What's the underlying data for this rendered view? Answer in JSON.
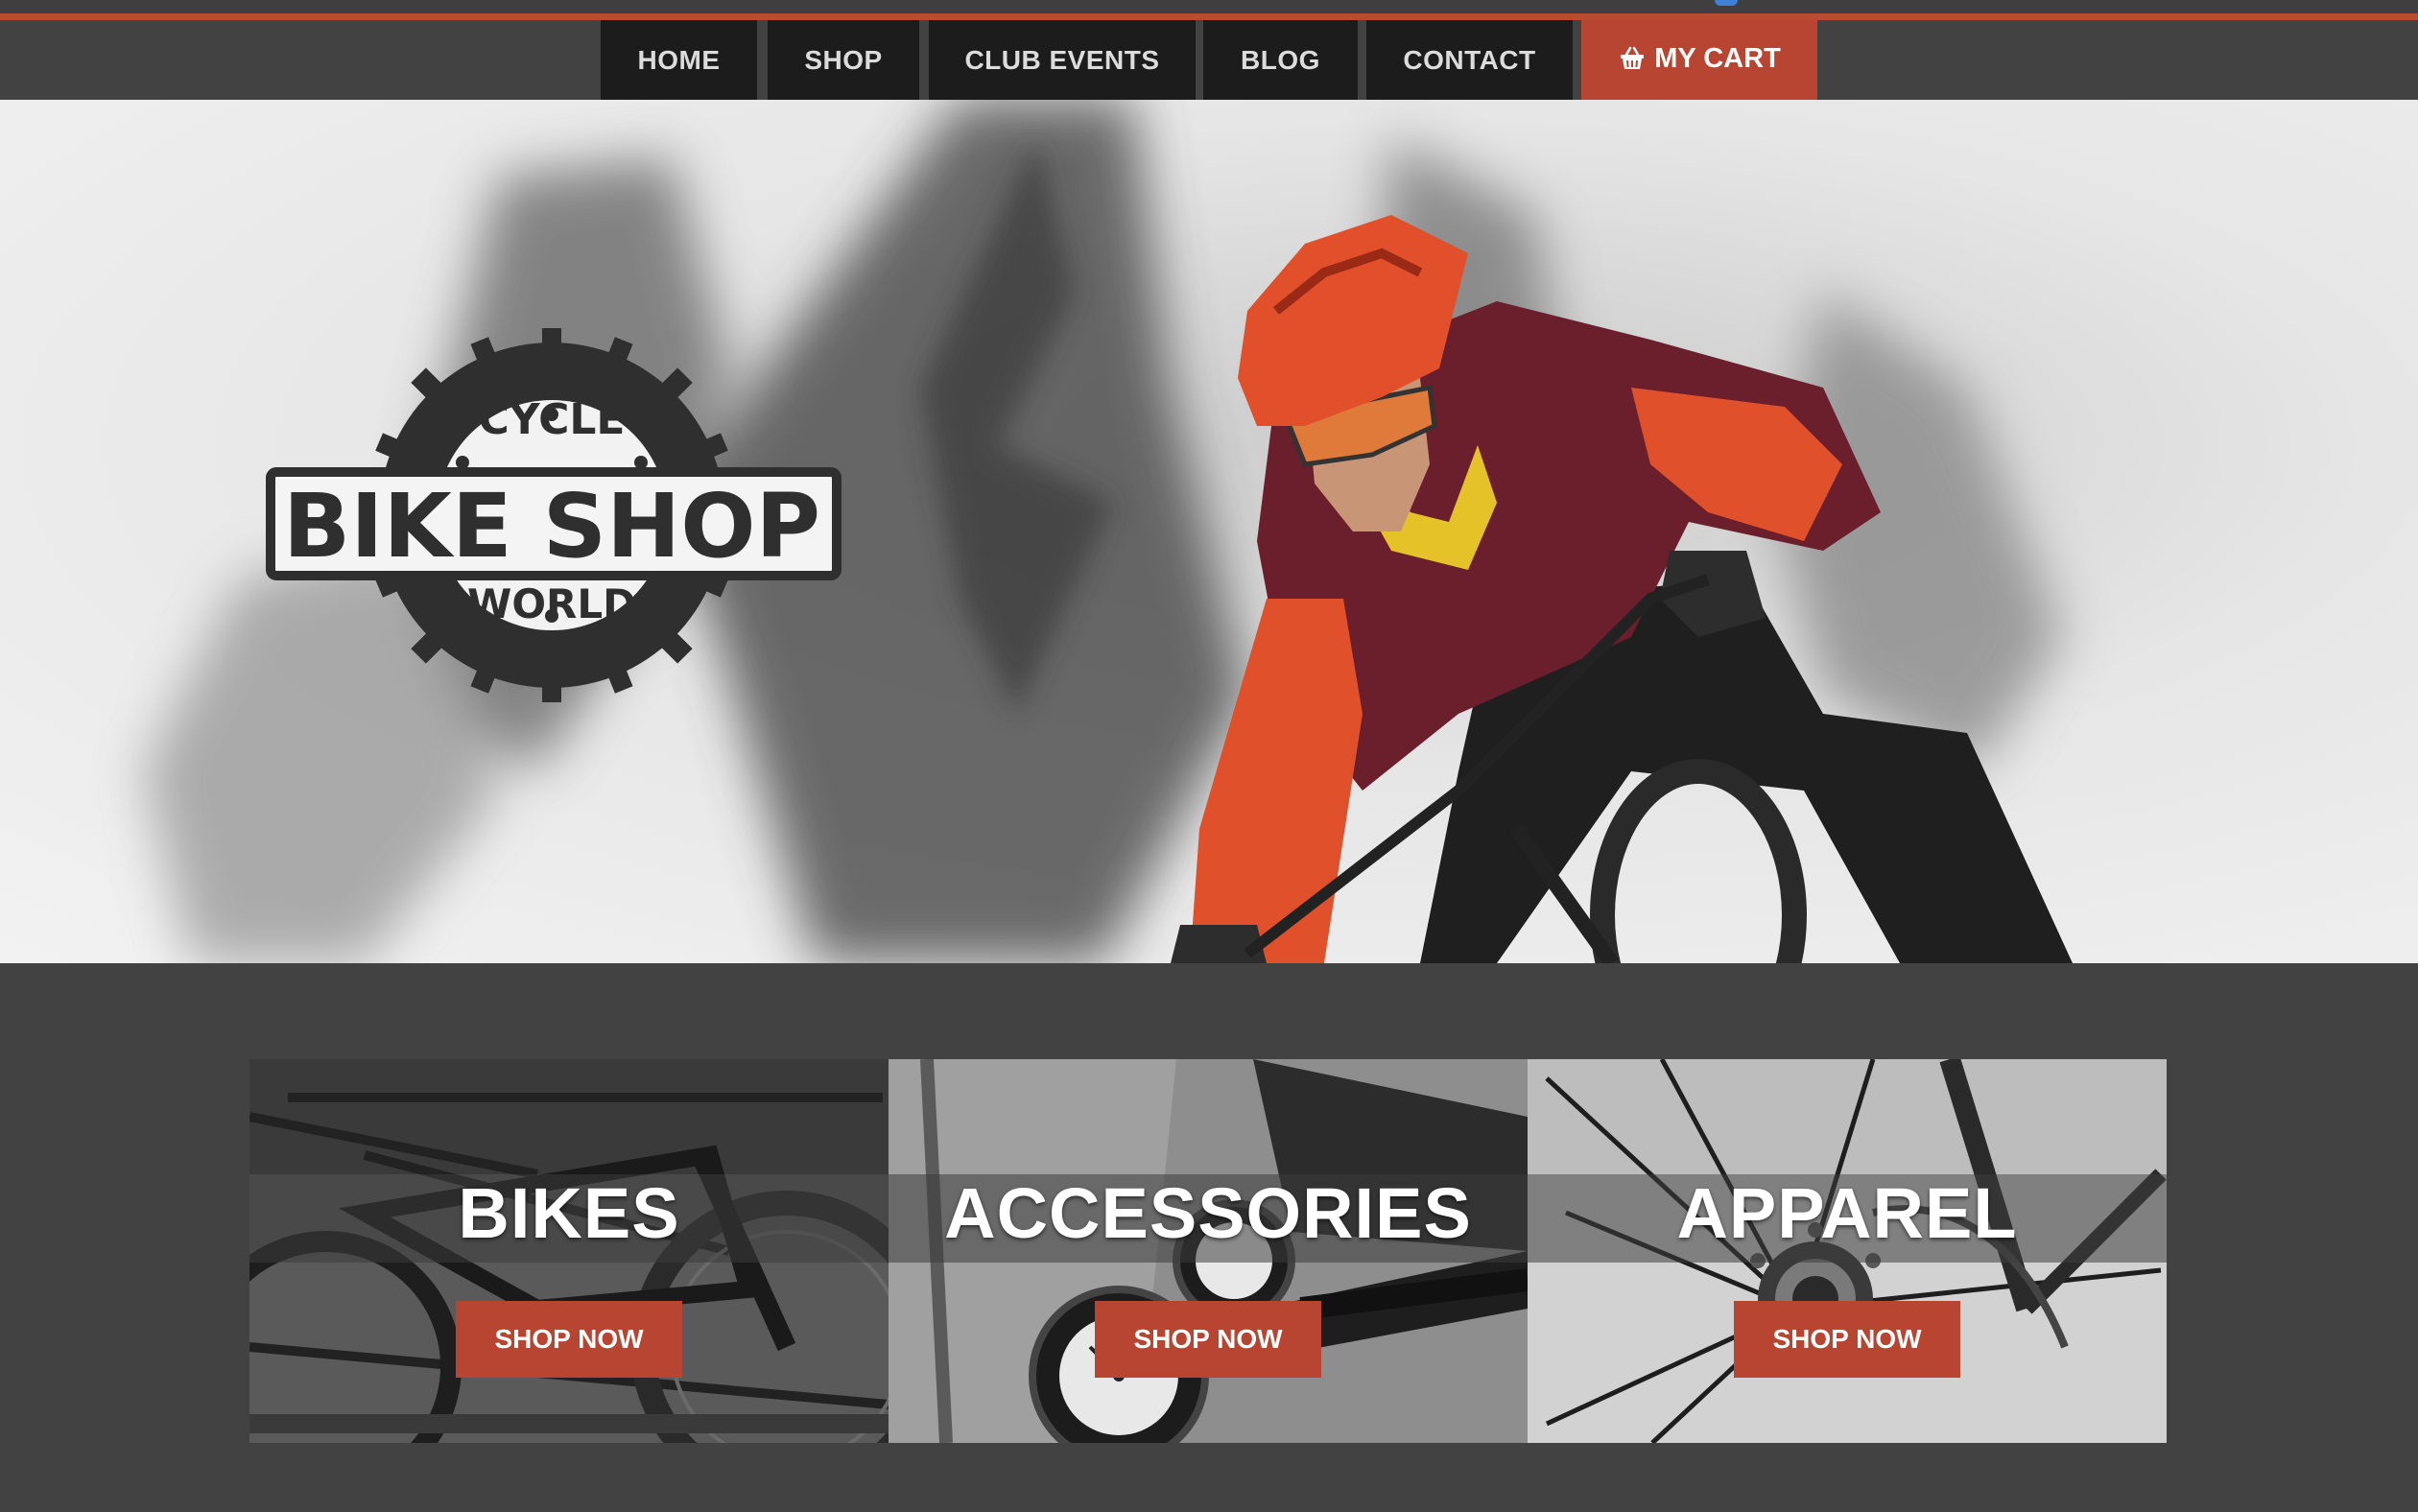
{
  "nav": {
    "items": [
      {
        "label": "HOME"
      },
      {
        "label": "SHOP"
      },
      {
        "label": "CLUB EVENTS"
      },
      {
        "label": "BLOG"
      },
      {
        "label": "CONTACT"
      }
    ],
    "cart": {
      "label": "MY CART",
      "icon": "basket-icon"
    }
  },
  "logo": {
    "top": "CYCLE",
    "main": "BIKE SHOP",
    "bottom": "WORLD"
  },
  "categories": [
    {
      "title": "BIKES",
      "button": "SHOP NOW"
    },
    {
      "title": "ACCESSORIES",
      "button": "SHOP NOW"
    },
    {
      "title": "APPAREL",
      "button": "SHOP NOW"
    }
  ],
  "colors": {
    "accent": "#b84532",
    "nav_bg": "#1c1c1c",
    "page_bg": "#424242"
  }
}
